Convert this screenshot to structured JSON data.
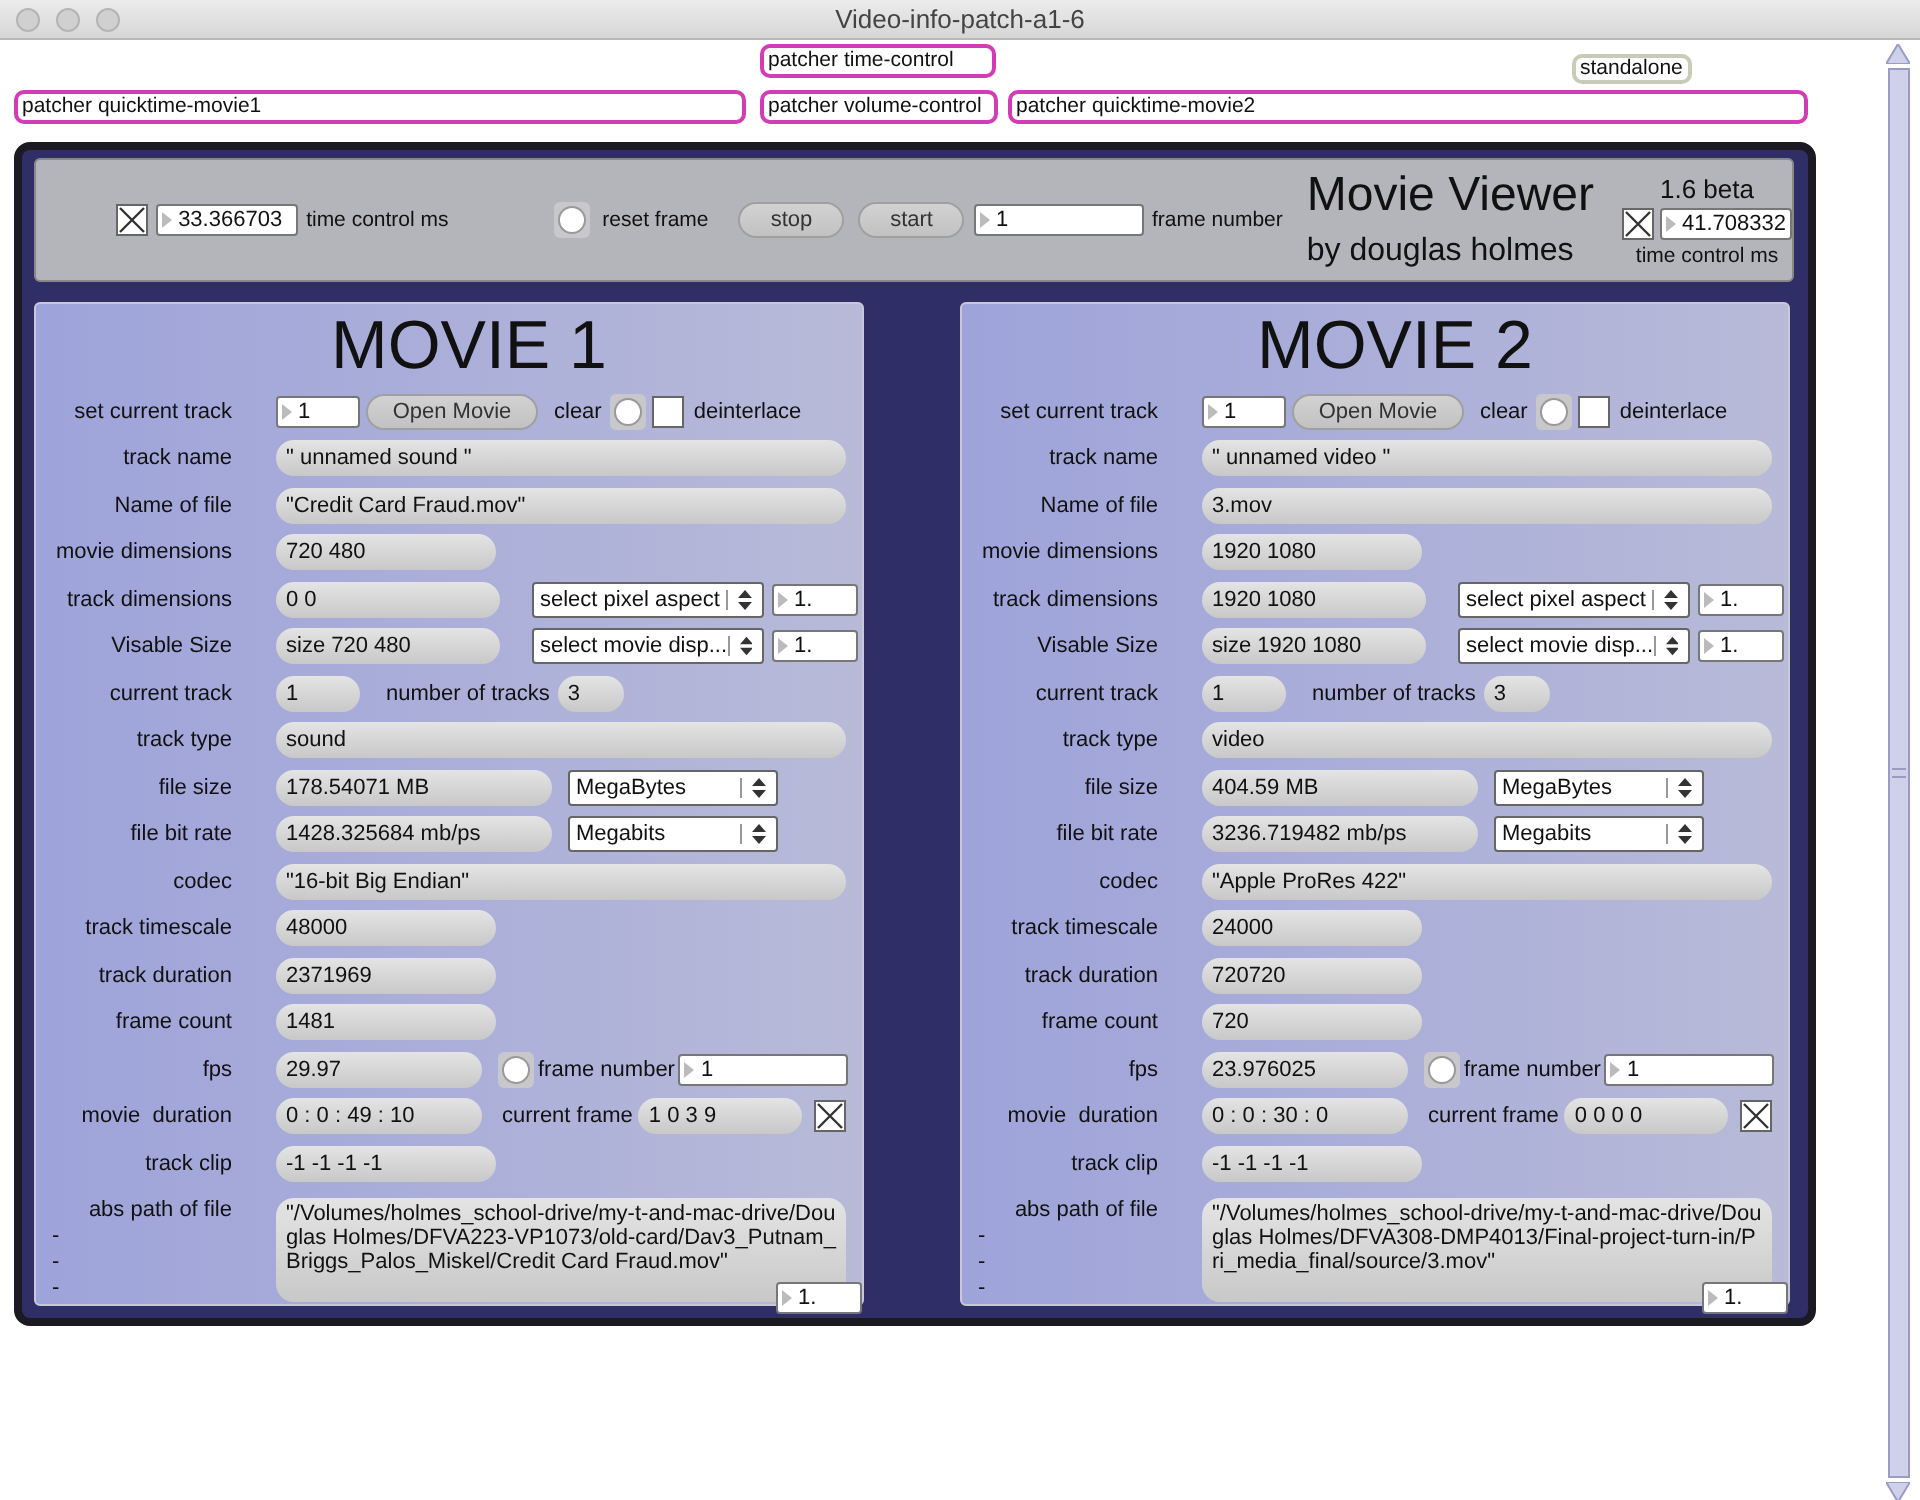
{
  "window": {
    "title": "Video-info-patch-a1-6"
  },
  "objects": [
    {
      "label": "patcher time-control",
      "kind": "patcher"
    },
    {
      "label": "standalone",
      "kind": "standalone"
    },
    {
      "label": "patcher quicktime-movie1",
      "kind": "patcher"
    },
    {
      "label": "patcher volume-control",
      "kind": "patcher"
    },
    {
      "label": "patcher quicktime-movie2",
      "kind": "patcher"
    }
  ],
  "toolbar": {
    "time_toggle": {
      "checked": true
    },
    "time_value": "33.366703",
    "time_label": "time control ms",
    "reset_label": "reset frame",
    "buttons": [
      "stop",
      "start"
    ],
    "frame_value": "1",
    "frame_label": "frame number",
    "title": "Movie Viewer",
    "subtitle": "by douglas holmes",
    "version": "1.6 beta",
    "toggle2": {
      "checked": true
    },
    "value2": "41.708332",
    "label2": "time control ms"
  },
  "movies": [
    {
      "title": "MOVIE 1",
      "rows": [
        {
          "kind": "control",
          "label": "set current track",
          "value": "1",
          "button": "Open Movie",
          "clear": "clear",
          "deinterlace": {
            "label": "deinterlace",
            "checked": false
          }
        },
        {
          "kind": "wide",
          "label": "track name",
          "value": "\" unnamed sound \""
        },
        {
          "kind": "wide",
          "label": "Name of file",
          "value": "\"Credit Card Fraud.mov\""
        },
        {
          "kind": "medium",
          "label": "movie dimensions",
          "value": "720 480"
        },
        {
          "kind": "menu",
          "label": "track dimensions",
          "value": "0 0",
          "menu": "select pixel aspect",
          "number": "1."
        },
        {
          "kind": "menu",
          "label": "Visable Size",
          "value": "size 720 480",
          "menu": "select movie disp...",
          "number": "1."
        },
        {
          "kind": "pair",
          "label": "current track",
          "value": "1",
          "label2": "number of tracks",
          "value2": "3"
        },
        {
          "kind": "wide",
          "label": "track type",
          "value": "sound"
        },
        {
          "kind": "unit",
          "label": "file size",
          "value": "178.54071 MB",
          "menu": "MegaBytes"
        },
        {
          "kind": "unit",
          "label": "file bit rate",
          "value": "1428.325684 mb/ps",
          "menu": "Megabits"
        },
        {
          "kind": "wide",
          "label": "codec",
          "value": "\"16-bit Big Endian\""
        },
        {
          "kind": "medium",
          "label": "track timescale",
          "value": "48000"
        },
        {
          "kind": "medium",
          "label": "track duration",
          "value": "2371969"
        },
        {
          "kind": "medium",
          "label": "frame count",
          "value": "1481"
        },
        {
          "kind": "frame",
          "label": "fps",
          "value": "29.97",
          "label2": "frame number",
          "number": "1"
        },
        {
          "kind": "duration",
          "label": "movie  duration",
          "value": "0 : 0 : 49 : 10",
          "label2": "current frame",
          "value2": "1 0 3 9",
          "checked": true
        },
        {
          "kind": "medium",
          "label": "track clip",
          "value": "-1 -1 -1 -1"
        },
        {
          "kind": "path",
          "label": "abs path of file",
          "dashes": [
            "-",
            "-",
            "-"
          ],
          "value": "\"/Volumes/holmes_school-drive/my-t-and-mac-drive/Douglas Holmes/DFVA223-VP1073/old-card/Dav3_Putnam_Briggs_Palos_Miskel/Credit Card Fraud.mov\"",
          "number": "1."
        }
      ]
    },
    {
      "title": "MOVIE 2",
      "rows": [
        {
          "kind": "control",
          "label": "set current track",
          "value": "1",
          "button": "Open Movie",
          "clear": "clear",
          "deinterlace": {
            "label": "deinterlace",
            "checked": false
          }
        },
        {
          "kind": "wide",
          "label": "track name",
          "value": "\" unnamed video \""
        },
        {
          "kind": "wide",
          "label": "Name of file",
          "value": "3.mov"
        },
        {
          "kind": "medium",
          "label": "movie dimensions",
          "value": "1920 1080"
        },
        {
          "kind": "menu",
          "label": "track dimensions",
          "value": "1920 1080",
          "menu": "select pixel aspect",
          "number": "1."
        },
        {
          "kind": "menu",
          "label": "Visable Size",
          "value": "size 1920 1080",
          "menu": "select movie disp...",
          "number": "1."
        },
        {
          "kind": "pair",
          "label": "current track",
          "value": "1",
          "label2": "number of tracks",
          "value2": "3"
        },
        {
          "kind": "wide",
          "label": "track type",
          "value": "video"
        },
        {
          "kind": "unit",
          "label": "file size",
          "value": "404.59 MB",
          "menu": "MegaBytes"
        },
        {
          "kind": "unit",
          "label": "file bit rate",
          "value": "3236.719482 mb/ps",
          "menu": "Megabits"
        },
        {
          "kind": "wide",
          "label": "codec",
          "value": "\"Apple ProRes 422\""
        },
        {
          "kind": "medium",
          "label": "track timescale",
          "value": "24000"
        },
        {
          "kind": "medium",
          "label": "track duration",
          "value": "720720"
        },
        {
          "kind": "medium",
          "label": "frame count",
          "value": "720"
        },
        {
          "kind": "frame",
          "label": "fps",
          "value": "23.976025",
          "label2": "frame number",
          "number": "1"
        },
        {
          "kind": "duration",
          "label": "movie  duration",
          "value": "0 : 0 : 30 : 0",
          "label2": "current frame",
          "value2": "0 0 0 0",
          "checked": true
        },
        {
          "kind": "medium",
          "label": "track clip",
          "value": "-1 -1 -1 -1"
        },
        {
          "kind": "path",
          "label": "abs path of file",
          "dashes": [
            "-",
            "-",
            "-"
          ],
          "value": "\"/Volumes/holmes_school-drive/my-t-and-mac-drive/Douglas Holmes/DFVA308-DMP4013/Final-project-turn-in/Pri_media_final/source/3.mov\"",
          "number": "1."
        }
      ]
    }
  ]
}
